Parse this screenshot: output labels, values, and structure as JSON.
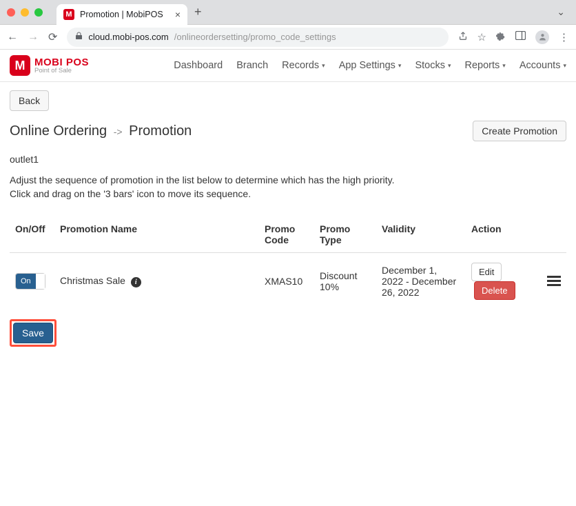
{
  "browser": {
    "tab_title": "Promotion | MobiPOS",
    "url_host": "cloud.mobi-pos.com",
    "url_path": "/onlineordersetting/promo_code_settings"
  },
  "logo": {
    "main": "MOBI POS",
    "sub": "Point of Sale"
  },
  "nav": {
    "dashboard": "Dashboard",
    "branch": "Branch",
    "records": "Records",
    "app_settings": "App Settings",
    "stocks": "Stocks",
    "reports": "Reports",
    "accounts": "Accounts"
  },
  "back_label": "Back",
  "title": {
    "section": "Online Ordering",
    "arrow": "->",
    "page": "Promotion"
  },
  "create_label": "Create Promotion",
  "outlet": "outlet1",
  "instructions_l1": "Adjust the sequence of promotion in the list below to determine which has the high priority.",
  "instructions_l2": "Click and drag on the '3 bars' icon to move its sequence.",
  "headers": {
    "onoff": "On/Off",
    "name": "Promotion Name",
    "code": "Promo Code",
    "type": "Promo Type",
    "validity": "Validity",
    "action": "Action"
  },
  "row": {
    "toggle_label": "On",
    "name": "Christmas Sale",
    "code": "XMAS10",
    "type": "Discount 10%",
    "validity": "December 1, 2022 - December 26, 2022",
    "edit": "Edit",
    "delete": "Delete"
  },
  "save_label": "Save"
}
